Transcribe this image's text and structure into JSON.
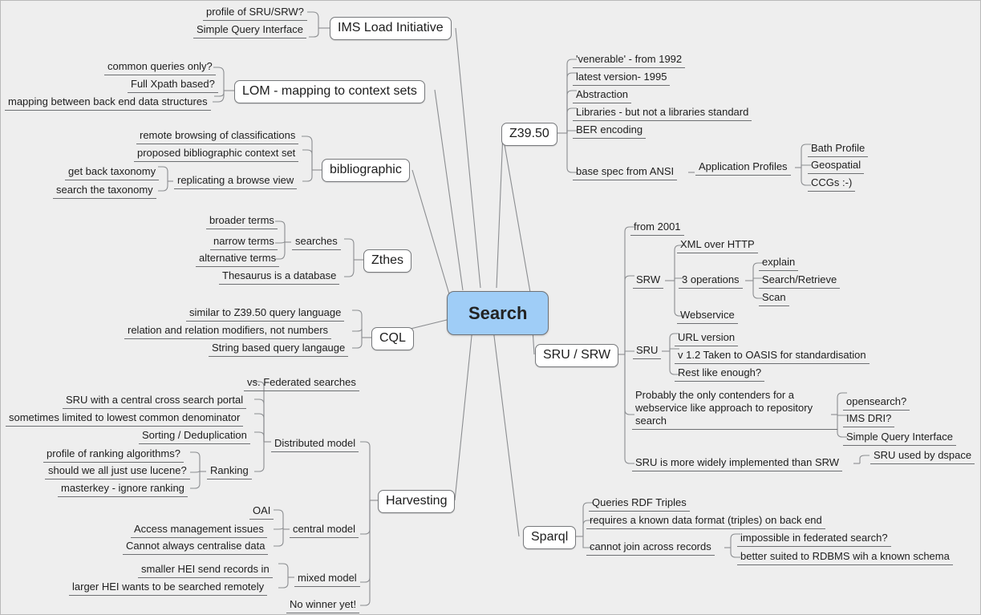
{
  "colors": {
    "background": "#eeeeee",
    "root_fill": "#9fcdf7",
    "node_fill": "#ffffff",
    "border": "#77797c",
    "text": "#1d1d1d",
    "edge": "#8b8d90"
  },
  "root": {
    "label": "Search"
  },
  "branches": [
    {
      "id": "ims-load-initiative",
      "label": "IMS Load Initiative",
      "children": [
        {
          "label": "profile of SRU/SRW?"
        },
        {
          "label": "Simple Query Interface"
        }
      ]
    },
    {
      "id": "lom-mapping-to-context-sets",
      "label": "LOM - mapping to context sets",
      "children": [
        {
          "label": "common queries only?"
        },
        {
          "label": "Full Xpath based?"
        },
        {
          "label": "mapping between back end data structures"
        }
      ]
    },
    {
      "id": "bibliographic",
      "label": "bibliographic",
      "children": [
        {
          "label": "remote browsing of classifications"
        },
        {
          "label": "proposed bibliographic context set"
        },
        {
          "label": "replicating a browse view",
          "children": [
            {
              "label": "get back taxonomy"
            },
            {
              "label": "search the taxonomy"
            }
          ]
        }
      ]
    },
    {
      "id": "zthes",
      "label": "Zthes",
      "children": [
        {
          "label": "searches",
          "children": [
            {
              "label": "broader terms"
            },
            {
              "label": "narrow terms"
            },
            {
              "label": "alternative terms"
            }
          ]
        },
        {
          "label": "Thesaurus is a database"
        }
      ]
    },
    {
      "id": "cql",
      "label": "CQL",
      "children": [
        {
          "label": "similar to Z39.50 query language"
        },
        {
          "label": "relation and relation modifiers, not numbers"
        },
        {
          "label": "String based query langauge"
        }
      ]
    },
    {
      "id": "harvesting",
      "label": "Harvesting",
      "children": [
        {
          "label": "Distributed model",
          "children": [
            {
              "label": "vs. Federated searches"
            },
            {
              "label": "SRU with a central cross search portal"
            },
            {
              "label": "sometimes limited to lowest common denominator"
            },
            {
              "label": "Sorting / Deduplication"
            },
            {
              "label": "Ranking",
              "children": [
                {
                  "label": "profile of ranking algorithms?"
                },
                {
                  "label": "should we all just use lucene?"
                },
                {
                  "label": "masterkey - ignore ranking"
                }
              ]
            }
          ]
        },
        {
          "label": "central model",
          "children": [
            {
              "label": "OAI"
            },
            {
              "label": "Access management issues"
            },
            {
              "label": "Cannot always centralise data"
            }
          ]
        },
        {
          "label": "mixed model",
          "children": [
            {
              "label": "smaller HEI send records in"
            },
            {
              "label": "larger HEI wants to be searched remotely"
            }
          ]
        },
        {
          "label": "No winner yet!"
        }
      ]
    },
    {
      "id": "z3950",
      "label": "Z39.50",
      "children": [
        {
          "label": "'venerable' - from 1992"
        },
        {
          "label": "latest version- 1995"
        },
        {
          "label": "Abstraction"
        },
        {
          "label": "Libraries - but not a libraries standard"
        },
        {
          "label": "BER encoding"
        },
        {
          "label": "base spec from ANSI",
          "children": [
            {
              "label": "Application Profiles",
              "children": [
                {
                  "label": "Bath Profile"
                },
                {
                  "label": "Geospatial"
                },
                {
                  "label": "CCGs :-)"
                }
              ]
            }
          ]
        }
      ]
    },
    {
      "id": "sru-srw",
      "label": "SRU / SRW",
      "children": [
        {
          "label": "from 2001"
        },
        {
          "label": "SRW",
          "children": [
            {
              "label": "XML over HTTP"
            },
            {
              "label": "3 operations",
              "children": [
                {
                  "label": "explain"
                },
                {
                  "label": "Search/Retrieve"
                },
                {
                  "label": "Scan"
                }
              ]
            },
            {
              "label": "Webservice"
            }
          ]
        },
        {
          "label": "SRU",
          "children": [
            {
              "label": "URL version"
            },
            {
              "label": "v 1.2 Taken to OASIS for standardisation"
            },
            {
              "label": "Rest like enough?"
            }
          ]
        },
        {
          "label": "Probably the only contenders for a webservice like approach to repository search",
          "children": [
            {
              "label": "opensearch?"
            },
            {
              "label": "IMS DRI?"
            },
            {
              "label": "Simple Query Interface"
            }
          ]
        },
        {
          "label": "SRU is more widely implemented than SRW",
          "children": [
            {
              "label": "SRU used by dspace"
            }
          ]
        }
      ]
    },
    {
      "id": "sparql",
      "label": "Sparql",
      "children": [
        {
          "label": "Queries RDF Triples"
        },
        {
          "label": "requires a known data format (triples) on back end"
        },
        {
          "label": "cannot join across records",
          "children": [
            {
              "label": "impossible in federated search?"
            },
            {
              "label": "better suited to RDBMS wih a known schema"
            }
          ]
        }
      ]
    }
  ]
}
